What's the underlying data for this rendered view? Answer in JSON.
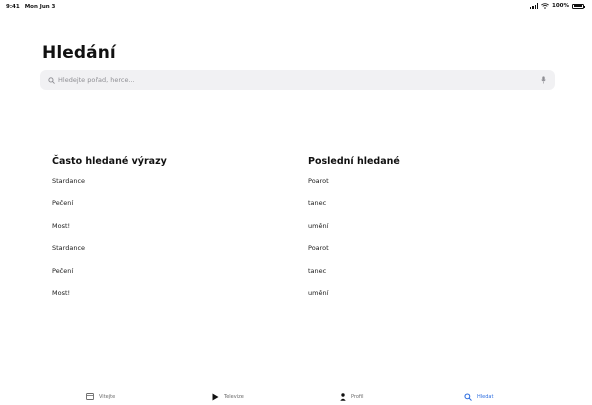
{
  "status_bar": {
    "time": "9:41",
    "date": "Mon Jun 3",
    "battery": "100%",
    "battery_level": 1.0
  },
  "page": {
    "title": "Hledání"
  },
  "search": {
    "placeholder": "Hledejte pořad, herce...",
    "value": ""
  },
  "frequent": {
    "title": "Často hledané výrazy",
    "items": [
      "Stardance",
      "Pečení",
      "Most!",
      "Stardance",
      "Pečení",
      "Most!"
    ]
  },
  "recent": {
    "title": "Poslední hledané",
    "items": [
      "Poarot",
      "tanec",
      "umění",
      "Poarot",
      "tanec",
      "umění"
    ]
  },
  "tab_bar": {
    "tabs": [
      {
        "label": "Vitejte",
        "icon": "home-icon"
      },
      {
        "label": "Televize",
        "icon": "play-icon"
      },
      {
        "label": "Profil",
        "icon": "person-icon"
      },
      {
        "label": "Hledat",
        "icon": "search-icon",
        "active": true
      }
    ]
  },
  "colors": {
    "accent": "#2f6fe0",
    "search_background": "#f1f1f3"
  }
}
